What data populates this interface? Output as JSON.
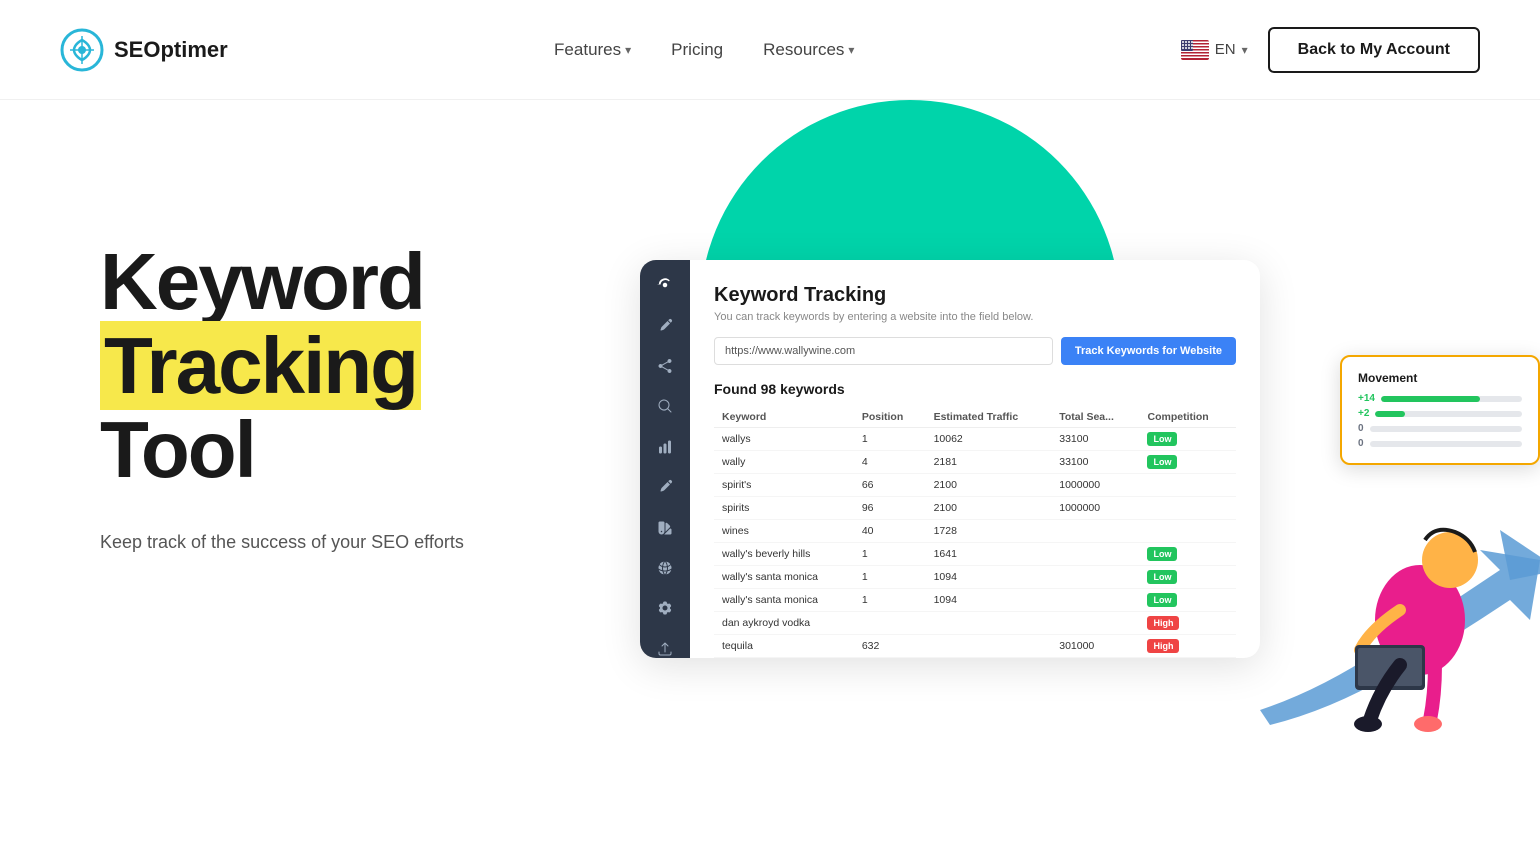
{
  "header": {
    "logo_text": "SEOptimer",
    "nav": [
      {
        "label": "Features",
        "has_dropdown": true
      },
      {
        "label": "Pricing",
        "has_dropdown": false
      },
      {
        "label": "Resources",
        "has_dropdown": true
      }
    ],
    "lang": "EN",
    "back_btn": "Back to My Account"
  },
  "hero": {
    "title_line1": "Keyword",
    "title_line2": "Tracking",
    "title_line3": "Tool",
    "subtitle": "Keep track of the success of your SEO efforts"
  },
  "dashboard": {
    "title": "Keyword Tracking",
    "subtitle": "You can track keywords by entering a website into the field below.",
    "input_value": "https://www.wallywine.com",
    "track_btn": "Track Keywords for Website",
    "found_text": "Found 98 keywords",
    "columns": [
      "Keyword",
      "Position",
      "Estimated Traffic",
      "Total Sea...",
      "Competition"
    ],
    "rows": [
      {
        "keyword": "wallys",
        "position": "1",
        "traffic": "10062",
        "total": "33100",
        "competition": "Low",
        "move": "+14"
      },
      {
        "keyword": "wally",
        "position": "4",
        "traffic": "2181",
        "total": "33100",
        "competition": "Low",
        "move": "+2"
      },
      {
        "keyword": "spirit's",
        "position": "66",
        "traffic": "2100",
        "total": "1000000",
        "competition": "",
        "move": ""
      },
      {
        "keyword": "spirits",
        "position": "96",
        "traffic": "2100",
        "total": "1000000",
        "competition": "",
        "move": ""
      },
      {
        "keyword": "wines",
        "position": "40",
        "traffic": "1728",
        "total": "",
        "competition": "",
        "move": ""
      },
      {
        "keyword": "wally's beverly hills",
        "position": "1",
        "traffic": "1641",
        "total": "",
        "competition": "Low",
        "move": ""
      },
      {
        "keyword": "wally's santa monica",
        "position": "1",
        "traffic": "1094",
        "total": "",
        "competition": "Low",
        "move": ""
      },
      {
        "keyword": "wally's santa monica",
        "position": "1",
        "traffic": "1094",
        "total": "",
        "competition": "Low",
        "move": ""
      },
      {
        "keyword": "dan aykroyd vodka",
        "position": "",
        "traffic": "",
        "total": "",
        "competition": "High",
        "move": ""
      },
      {
        "keyword": "tequila",
        "position": "632",
        "traffic": "",
        "total": "301000",
        "competition": "High",
        "move": ""
      }
    ],
    "movement_popup_title": "Movement"
  },
  "colors": {
    "green_circle": "#00d4aa",
    "accent_blue": "#3b82f6",
    "sidebar_dark": "#2d3748",
    "badge_low": "#22c55e",
    "badge_high": "#ef4444",
    "arrow_blue": "#5b9bd5",
    "highlight_yellow": "#f7e84b"
  }
}
